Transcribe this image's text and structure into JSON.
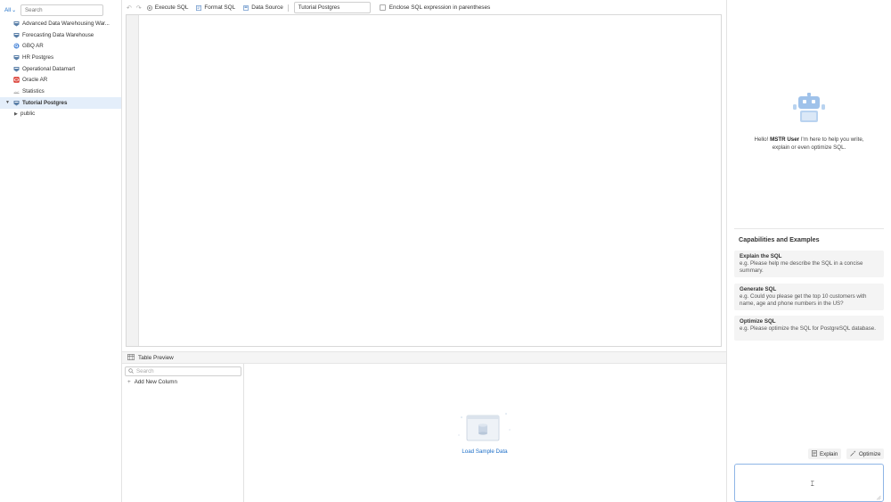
{
  "sidebar": {
    "filter_label": "All",
    "search_placeholder": "Search",
    "items": [
      {
        "label": "Advanced Data Warehousing War...",
        "icon": "warehouse-icon"
      },
      {
        "label": "Forecasting Data Warehouse",
        "icon": "warehouse-icon"
      },
      {
        "label": "GBQ AR",
        "icon": "bigquery-icon"
      },
      {
        "label": "HR Postgres",
        "icon": "postgres-icon"
      },
      {
        "label": "Operational Datamart",
        "icon": "warehouse-icon"
      },
      {
        "label": "Oracle AR",
        "icon": "oracle-icon"
      },
      {
        "label": "Statistics",
        "icon": "statistics-icon"
      },
      {
        "label": "Tutorial Postgres",
        "icon": "postgres-icon"
      },
      {
        "label": "public",
        "icon": "schema-icon"
      }
    ]
  },
  "toolbar": {
    "execute_label": "Execute SQL",
    "format_label": "Format SQL",
    "data_source_label": "Data Source",
    "data_source_value": "Tutorial Postgres",
    "enclose_label": "Enclose SQL expression in parentheses"
  },
  "preview": {
    "title": "Table Preview",
    "search_placeholder": "Search",
    "add_column_label": "Add New Column",
    "load_sample_label": "Load Sample Data"
  },
  "assistant": {
    "greeting_prefix": "Hello!",
    "user_name": "MSTR User",
    "greeting_suffix": "I'm here to help you write, explain or even optimize SQL.",
    "capabilities_title": "Capabilities and Examples",
    "capabilities": [
      {
        "title": "Explain the SQL",
        "example": "e.g. Please help me describe the SQL in a concise summary."
      },
      {
        "title": "Generate SQL",
        "example": "e.g. Could you please get the top 10 customers with name, age and phone numbers in the US?"
      },
      {
        "title": "Optimize SQL",
        "example": "e.g. Please optimize the SQL for PostgreSQL database."
      }
    ],
    "explain_button": "Explain",
    "optimize_button": "Optimize"
  },
  "colors": {
    "accent": "#1e6fc8",
    "selected_bg": "#e4eefa",
    "robot": "#9fc2ea"
  }
}
